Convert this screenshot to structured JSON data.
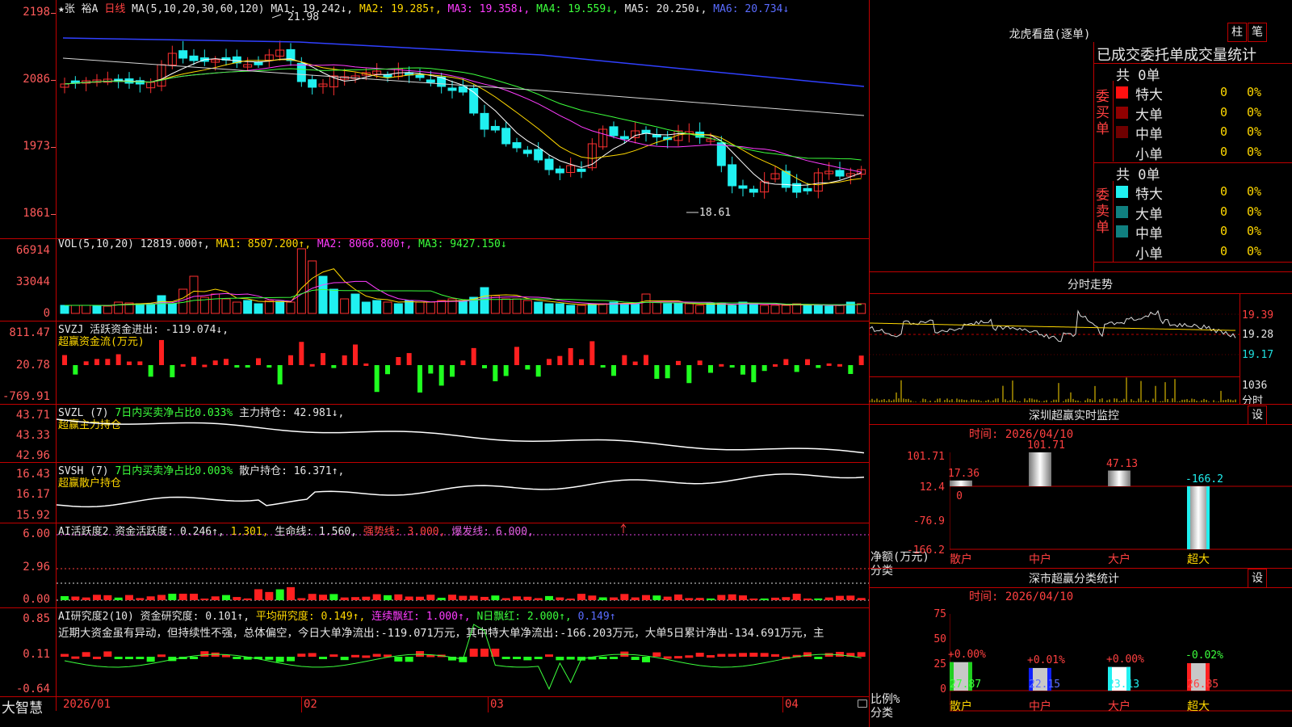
{
  "stock": {
    "header": "★张 裕A",
    "period": "日线",
    "ma_label": "MA(5,10,20,30,60,120)",
    "ma1": "MA1: 19.242↓,",
    "ma2": "MA2: 19.285↑,",
    "ma3": "MA3: 19.358↓,",
    "ma4": "MA4: 19.559↓,",
    "ma5": "MA5: 20.250↓,",
    "ma6": "MA6: 20.734↓",
    "high_note": "21.98",
    "low_note": "18.61",
    "yaxis": [
      "2198",
      "2086",
      "1973",
      "1861"
    ]
  },
  "vol": {
    "label": "VOL(5,10,20)",
    "value": "12819.000↑,",
    "ma1": "MA1: 8507.200↑,",
    "ma2": "MA2: 8066.800↑,",
    "ma3": "MA3: 9427.150↓",
    "yaxis": [
      "66914",
      "33044",
      "0"
    ]
  },
  "svzj": {
    "label": "SVZJ  活跃资金进出: -119.074↓,",
    "sub": "超赢资金流(万元)",
    "yaxis": [
      "811.47",
      "20.78",
      "-769.91"
    ]
  },
  "svzl": {
    "label": "SVZL (7)",
    "g": "7日内买卖净占比0.033%",
    "w": "主力持仓: 42.981↓,",
    "sub": "超赢主力持仓",
    "yaxis": [
      "43.71",
      "43.33",
      "42.96"
    ]
  },
  "svsh": {
    "label": "SVSH (7)",
    "g": "7日内买卖净占比0.003%",
    "w": "散户持仓: 16.371↑,",
    "sub": "超赢散户持仓",
    "yaxis": [
      "16.43",
      "16.17",
      "15.92"
    ]
  },
  "ai1": {
    "label": "AI活跃度2 资金活跃度: 0.246↑,",
    "v2": "1.301,",
    "v3": "生命线: 1.560,",
    "v4": "强势线: 3.000,",
    "v5": "爆发线: 6.000,",
    "yaxis": [
      "6.00",
      "2.96",
      "0.00"
    ]
  },
  "ai2": {
    "label": "AI研究度2(10) 资金研究度: 0.101↑,",
    "avg": "平均研究度: 0.149↑,",
    "lx": "连续飘红: 1.000↑,",
    "nr": "N日飘红: 2.000↑,",
    "last": "0.149↑",
    "desc": "近期大资金虽有异动，但持续性不强，总体偏空，今日大单净流出:-119.071万元，其中特大单净流出:-166.203万元，大单5日累计净出-134.691万元，主",
    "yaxis": [
      "0.85",
      "0.11",
      "-0.64"
    ]
  },
  "xaxis": [
    "2026/01",
    "02",
    "03",
    "04"
  ],
  "brand": "大智慧",
  "lhkp": {
    "title": "龙虎看盘(逐单)",
    "btn1": "柱",
    "btn2": "笔",
    "subtitle": "已成交委托单成交量统计",
    "buy_total": "共 0单",
    "sell_total": "共 0单",
    "buy_label": "委买单",
    "sell_label": "委卖单",
    "rows": [
      "特大",
      "大单",
      "中单",
      "小单"
    ],
    "count": "0",
    "pct": "0%"
  },
  "fenshi": {
    "title": "分时走势",
    "yaxis": [
      "19.39",
      "19.28",
      "19.17"
    ],
    "vol_label": "1036",
    "vol_unit": "分时"
  },
  "sz_monitor": {
    "title": "深圳超赢实时监控",
    "btn": "设",
    "time": "时间: 2026/04/10",
    "yaxis": [
      "101.71",
      "12.4",
      "0",
      "-76.9",
      "-166.2"
    ],
    "bars": [
      {
        "label": "散户",
        "value": "17.36"
      },
      {
        "label": "中户",
        "value": "101.71"
      },
      {
        "label": "大户",
        "value": "47.13"
      },
      {
        "label": "超大",
        "value": "-166.2"
      }
    ],
    "ylabel": "净额(万元)",
    "xlabel": "分类"
  },
  "sz_category": {
    "title": "深市超赢分类统计",
    "btn": "设",
    "time": "时间: 2026/04/10",
    "yaxis": [
      "75",
      "50",
      "25",
      "0"
    ],
    "bars": [
      {
        "label": "散户",
        "change": "+0.00%",
        "value": "27.87"
      },
      {
        "label": "中户",
        "change": "+0.01%",
        "value": "22.15"
      },
      {
        "label": "大户",
        "change": "+0.00%",
        "value": "23.13"
      },
      {
        "label": "超大",
        "change": "-0.02%",
        "value": "26.85"
      }
    ],
    "ylabel": "比例%",
    "xlabel": "分类"
  }
}
